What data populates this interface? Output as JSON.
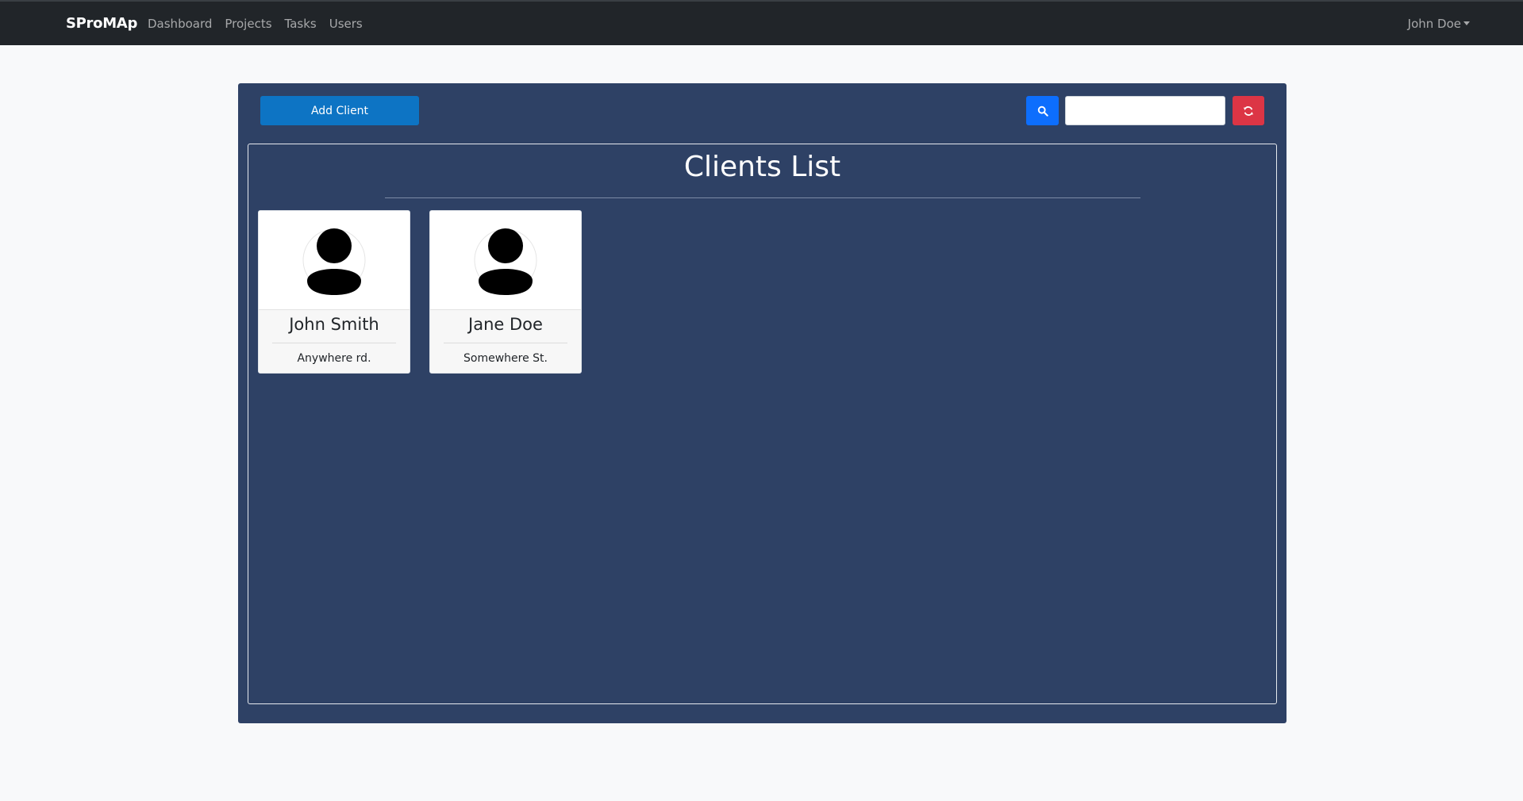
{
  "navbar": {
    "brand": "SProMAp",
    "links": [
      "Dashboard",
      "Projects",
      "Tasks",
      "Users"
    ],
    "user": "John Doe"
  },
  "toolbar": {
    "add_label": "Add Client",
    "search_icon": "search-icon",
    "search_value": "",
    "refresh_icon": "refresh-icon"
  },
  "list": {
    "title": "Clients List",
    "clients": [
      {
        "name": "John Smith",
        "address": "Anywhere rd.",
        "avatar": "user-avatar-icon"
      },
      {
        "name": "Jane Doe",
        "address": "Somewhere St.",
        "avatar": "user-avatar-icon"
      }
    ]
  },
  "colors": {
    "navbar": "#212529",
    "panel": "#2e4165",
    "primary": "#0d74c4",
    "search": "#0d6efd",
    "danger": "#dc3545"
  }
}
